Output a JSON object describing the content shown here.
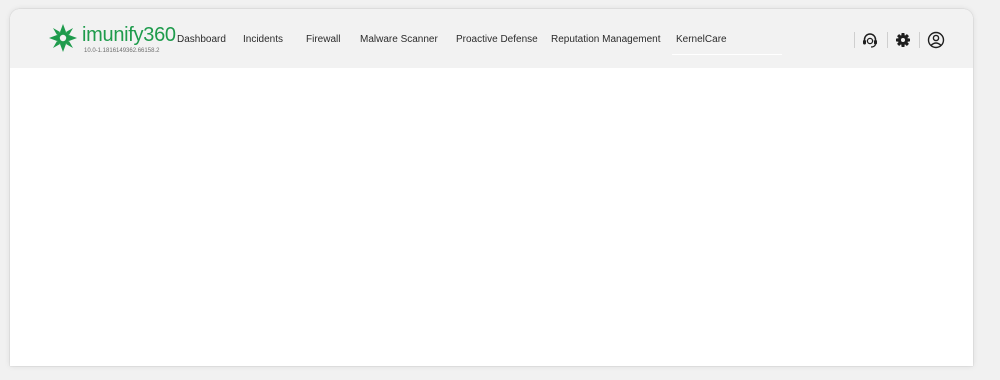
{
  "app": {
    "brand": "imunify360",
    "version": "10.0-1.1816149362.66158.2",
    "brand_color": "#1e9b4c"
  },
  "nav": {
    "items": [
      {
        "label": "Dashboard"
      },
      {
        "label": "Incidents"
      },
      {
        "label": "Firewall"
      },
      {
        "label": "Malware Scanner"
      },
      {
        "label": "Proactive Defense"
      },
      {
        "label": "Reputation Management"
      },
      {
        "label": "KernelCare"
      }
    ]
  },
  "toolbar": {
    "icons": [
      "support-icon",
      "gear-icon",
      "user-icon"
    ]
  }
}
